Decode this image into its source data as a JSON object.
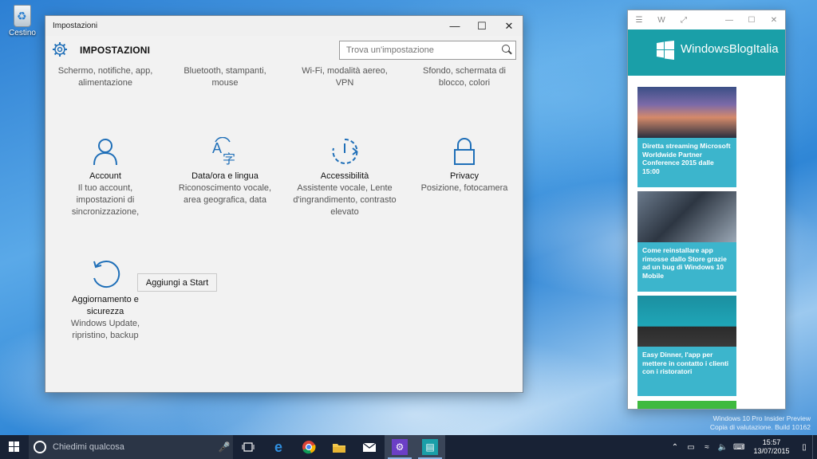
{
  "desktop": {
    "recycle_bin_label": "Cestino",
    "watermark_line1": "Windows 10 Pro Insider Preview",
    "watermark_line2": "Copia di valutazione. Build 10162"
  },
  "settings_window": {
    "title": "Impostazioni",
    "heading": "IMPOSTAZIONI",
    "search_placeholder": "Trova un'impostazione",
    "top_row": [
      {
        "desc": "Schermo, notifiche, app, alimentazione"
      },
      {
        "desc": "Bluetooth, stampanti, mouse"
      },
      {
        "desc": "Wi-Fi, modalità aereo, VPN"
      },
      {
        "desc": "Sfondo, schermata di blocco, colori"
      }
    ],
    "categories": [
      {
        "name": "Account",
        "desc": "Il tuo account, impostazioni di sincronizzazione,",
        "icon": "person-icon"
      },
      {
        "name": "Data/ora e lingua",
        "desc": "Riconoscimento vocale, area geografica, data",
        "icon": "time-language-icon"
      },
      {
        "name": "Accessibilità",
        "desc": "Assistente vocale, Lente d'ingrandimento, contrasto elevato",
        "icon": "ease-of-access-icon"
      },
      {
        "name": "Privacy",
        "desc": "Posizione, fotocamera",
        "icon": "lock-icon"
      },
      {
        "name": "Aggiornamento e sicurezza",
        "desc": "Windows Update, ripristino, backup",
        "icon": "update-icon"
      }
    ],
    "tooltip": "Aggiungi a Start"
  },
  "app_window": {
    "titlebar_w": "W",
    "brand": "WindowsBlogItalia",
    "articles": [
      {
        "title": "Diretta streaming Microsoft Worldwide Partner Conference 2015 dalle 15:00"
      },
      {
        "title": "Come reinstallare app rimosse dallo Store grazie ad un bug di Windows 10 Mobile"
      },
      {
        "title": "Easy Dinner, l'app per mettere in contatto i clienti con i ristoratori"
      }
    ]
  },
  "taskbar": {
    "search_placeholder": "Chiedimi qualcosa",
    "clock_time": "15:57",
    "clock_date": "13/07/2015"
  },
  "colors": {
    "app_accent": "#1a9fa8",
    "card_caption": "#3cb5cc",
    "taskbar": "#182235"
  }
}
